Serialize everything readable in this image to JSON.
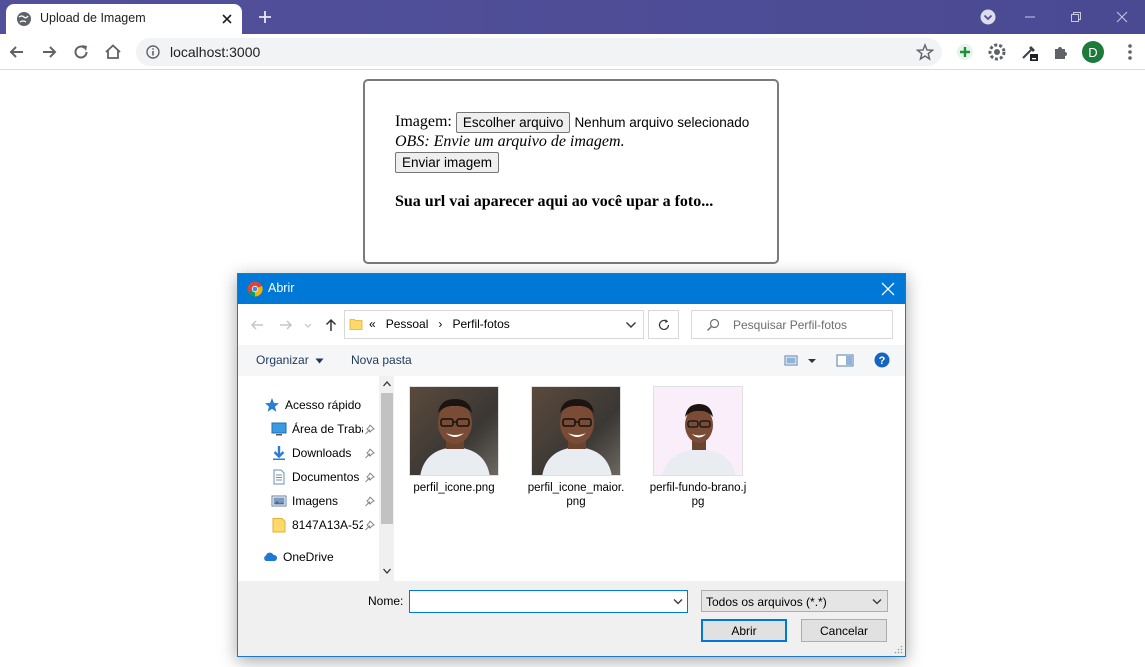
{
  "browser": {
    "tab_title": "Upload de Imagem",
    "url": "localhost:3000",
    "profile_initial": "D"
  },
  "page": {
    "image_label": "Imagem:",
    "choose_file_button": "Escolher arquivo",
    "file_status": "Nenhum arquivo selecionado",
    "obs_text": "OBS: Envie um arquivo de imagem.",
    "send_button": "Enviar imagem",
    "url_message": "Sua url vai aparecer aqui ao você upar a foto..."
  },
  "dialog": {
    "title": "Abrir",
    "breadcrumb": {
      "prefix": "«",
      "items": [
        "Pessoal",
        "Perfil-fotos"
      ],
      "separator": "›"
    },
    "search_placeholder": "Pesquisar Perfil-fotos",
    "organize_label": "Organizar",
    "new_folder_label": "Nova pasta",
    "nav_items": [
      {
        "label": "Acesso rápido",
        "icon": "star-icon",
        "pinned": false
      },
      {
        "label": "Área de Trabalho",
        "icon": "desktop-icon",
        "pinned": true
      },
      {
        "label": "Downloads",
        "icon": "download-icon",
        "pinned": true
      },
      {
        "label": "Documentos",
        "icon": "document-icon",
        "pinned": true
      },
      {
        "label": "Imagens",
        "icon": "pictures-icon",
        "pinned": true
      },
      {
        "label": "8147A13A-52",
        "icon": "folder-icon",
        "pinned": true
      },
      {
        "label": "OneDrive",
        "icon": "cloud-icon",
        "pinned": false
      }
    ],
    "files": [
      {
        "name": "perfil_icone.png",
        "background": "dark"
      },
      {
        "name": "perfil_icone_maior.png",
        "background": "dark"
      },
      {
        "name": "perfil-fundo-brano.jpg",
        "background": "pink"
      }
    ],
    "filename_label": "Nome:",
    "filename_value": "",
    "filetype_value": "Todos os arquivos (*.*)",
    "open_button": "Abrir",
    "cancel_button": "Cancelar"
  },
  "colors": {
    "titlebar": "#4f4e98",
    "dialog_titlebar": "#0078d7",
    "accent_blue": "#0078d7"
  }
}
